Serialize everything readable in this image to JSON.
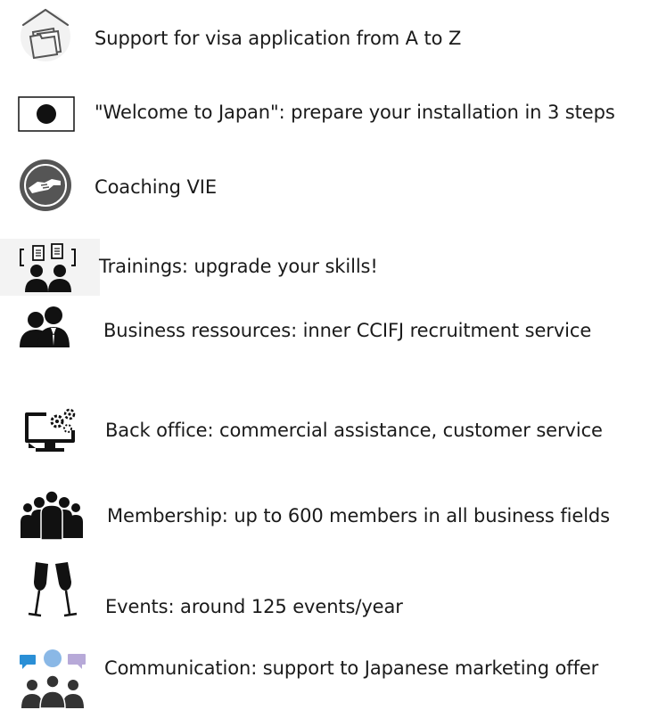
{
  "services": [
    {
      "label": "Support for visa application from A to Z",
      "icon": "folder-house-icon"
    },
    {
      "label": "\"Welcome to Japan\": prepare your installation in 3 steps",
      "icon": "japan-flag-icon"
    },
    {
      "label": "Coaching VIE",
      "icon": "handshake-icon"
    },
    {
      "label": "Trainings: upgrade your skills!",
      "icon": "training-people-icon"
    },
    {
      "label": "Business ressources: inner CCIFJ recruitment service",
      "icon": "business-people-icon"
    },
    {
      "label": "Back office: commercial assistance, customer service",
      "icon": "monitor-gears-icon"
    },
    {
      "label": "Membership: up to 600 members in all business fields",
      "icon": "group-icon"
    },
    {
      "label": "Events: around 125 events/year",
      "icon": "champagne-glasses-icon"
    },
    {
      "label": "Communication: support to Japanese marketing offer",
      "icon": "chat-group-icon"
    }
  ],
  "colors": {
    "text": "#1a1a1a",
    "icon_dark": "#111111",
    "icon_gray": "#555555",
    "chat_blue": "#2a8fd6",
    "chat_lightblue": "#8ab8e6",
    "chat_purple": "#b7a9d8"
  }
}
